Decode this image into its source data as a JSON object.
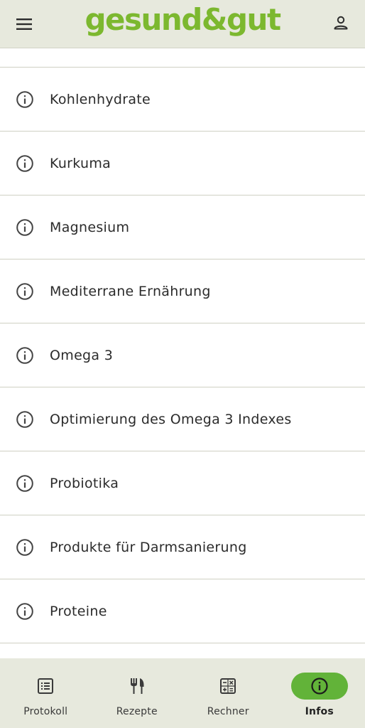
{
  "header": {
    "logo": "gesund&gut",
    "menu_icon": "hamburger-menu-icon",
    "profile_icon": "person-icon"
  },
  "list": {
    "item_icon": "info-icon",
    "items": [
      {
        "label": "Kohlenhydrate"
      },
      {
        "label": "Kurkuma"
      },
      {
        "label": "Magnesium"
      },
      {
        "label": "Mediterrane Ernährung"
      },
      {
        "label": "Omega 3"
      },
      {
        "label": "Optimierung des Omega 3 Indexes"
      },
      {
        "label": "Probiotika"
      },
      {
        "label": "Produkte für Darmsanierung"
      },
      {
        "label": "Proteine"
      }
    ]
  },
  "bottom_nav": {
    "items": [
      {
        "label": "Protokoll",
        "icon": "list-icon",
        "active": false
      },
      {
        "label": "Rezepte",
        "icon": "fork-knife-icon",
        "active": false
      },
      {
        "label": "Rechner",
        "icon": "calculator-icon",
        "active": false
      },
      {
        "label": "Infos",
        "icon": "info-icon",
        "active": true
      }
    ]
  },
  "colors": {
    "brand_green": "#7cb82f",
    "active_pill": "#62b339",
    "bar_background": "#e7e9dd"
  }
}
